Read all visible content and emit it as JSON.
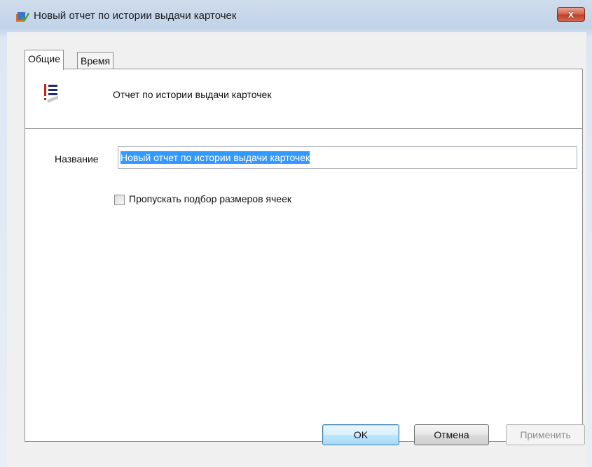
{
  "window": {
    "title": "Новый отчет по истории выдачи карточек",
    "icon": "report-app-icon",
    "close_label": "x",
    "close_icon": "close-icon"
  },
  "tabs": [
    {
      "label": "Общие",
      "active": true
    },
    {
      "label": "Время",
      "active": false
    }
  ],
  "general": {
    "report_type_icon": "report-list-icon",
    "report_type_label": "Отчет по истории выдачи карточек",
    "name_label": "Название",
    "name_value": "Новый отчет по истории выдачи карточек",
    "skip_cell_sizing_label": "Пропускать подбор размеров ячеек",
    "skip_cell_sizing_checked": false
  },
  "buttons": {
    "ok": "OK",
    "cancel": "Отмена",
    "apply": "Применить"
  },
  "colors": {
    "selection": "#3399ff",
    "close_button": "#c0402a",
    "report_icon_red": "#d0201c"
  }
}
